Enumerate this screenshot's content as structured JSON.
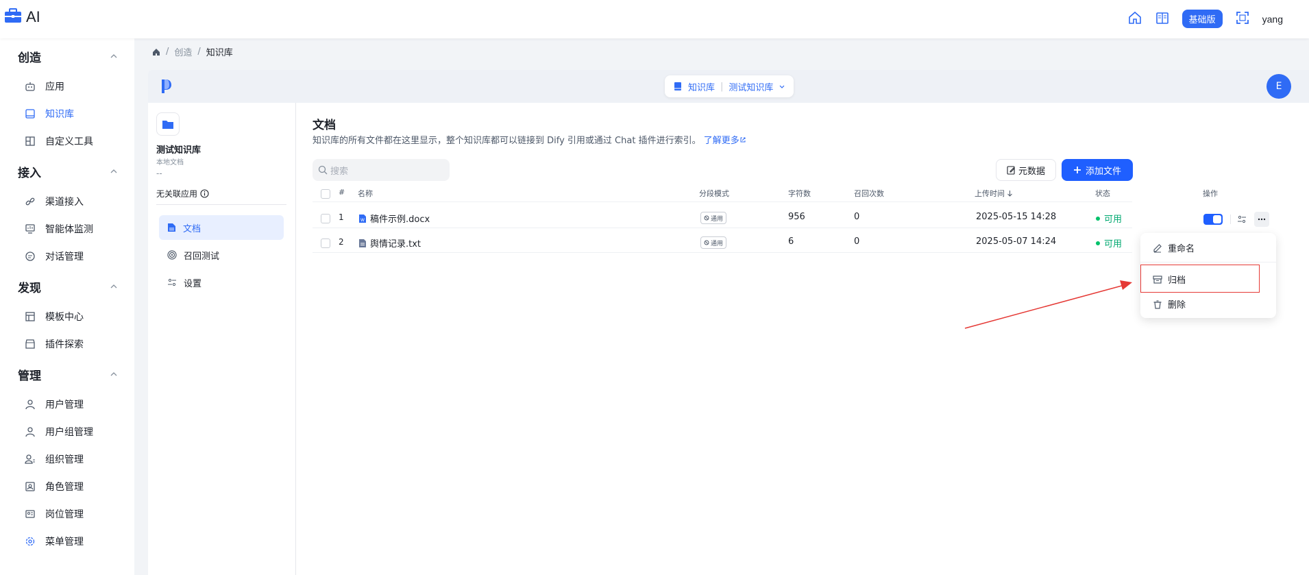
{
  "brand": {
    "text": "AI"
  },
  "topbar": {
    "badge": "基础版",
    "user": "yang"
  },
  "sidebar": {
    "groups": [
      {
        "title": "创造",
        "items": [
          {
            "label": "应用",
            "icon": "robot-icon"
          },
          {
            "label": "知识库",
            "icon": "book-icon",
            "active": true
          },
          {
            "label": "自定义工具",
            "icon": "tool-icon"
          }
        ]
      },
      {
        "title": "接入",
        "items": [
          {
            "label": "渠道接入",
            "icon": "link-icon"
          },
          {
            "label": "智能体监测",
            "icon": "monitor-icon"
          },
          {
            "label": "对话管理",
            "icon": "chat-icon"
          }
        ]
      },
      {
        "title": "发现",
        "items": [
          {
            "label": "模板中心",
            "icon": "template-icon"
          },
          {
            "label": "插件探索",
            "icon": "store-icon"
          }
        ]
      },
      {
        "title": "管理",
        "items": [
          {
            "label": "用户管理",
            "icon": "user-icon"
          },
          {
            "label": "用户组管理",
            "icon": "user-group-icon"
          },
          {
            "label": "组织管理",
            "icon": "org-icon"
          },
          {
            "label": "角色管理",
            "icon": "role-icon"
          },
          {
            "label": "岗位管理",
            "icon": "post-icon"
          },
          {
            "label": "菜单管理",
            "icon": "menu-icon"
          }
        ]
      }
    ]
  },
  "breadcrumb": {
    "sep": "/",
    "items": [
      "创造",
      "知识库"
    ]
  },
  "kb_header": {
    "section": "知识库",
    "current": "测试知识库",
    "avatar": "E"
  },
  "kb_panel": {
    "name": "测试知识库",
    "type": "本地文档",
    "dash": "--",
    "no_link": "无关联应用",
    "nav": [
      {
        "label": "文档",
        "active": true
      },
      {
        "label": "召回测试"
      },
      {
        "label": "设置"
      }
    ]
  },
  "docs": {
    "title": "文档",
    "desc": "知识库的所有文件都在这里显示，整个知识库都可以链接到 Dify 引用或通过 Chat 插件进行索引。",
    "learn_more": "了解更多",
    "search_placeholder": "搜索",
    "meta_btn": "元数据",
    "add_btn": "添加文件",
    "columns": {
      "num": "#",
      "name": "名称",
      "mode": "分段模式",
      "chars": "字符数",
      "recall": "召回次数",
      "upload": "上传时间",
      "status": "状态",
      "actions": "操作"
    },
    "rows": [
      {
        "num": "1",
        "name": "稿件示例.docx",
        "mode": "通用",
        "chars": "956",
        "recall": "0",
        "upload": "2025-05-15 14:28",
        "status": "可用",
        "file_icon": "word-file-icon"
      },
      {
        "num": "2",
        "name": "舆情记录.txt",
        "mode": "通用",
        "chars": "6",
        "recall": "0",
        "upload": "2025-05-07 14:24",
        "status": "可用",
        "file_icon": "text-file-icon"
      }
    ]
  },
  "menu": {
    "rename": "重命名",
    "archive": "归档",
    "delete": "删除"
  },
  "colors": {
    "accent": "#2f6bf5",
    "primary_button": "#1f5fff",
    "status_ok": "#00a870",
    "highlight": "#e53935"
  }
}
